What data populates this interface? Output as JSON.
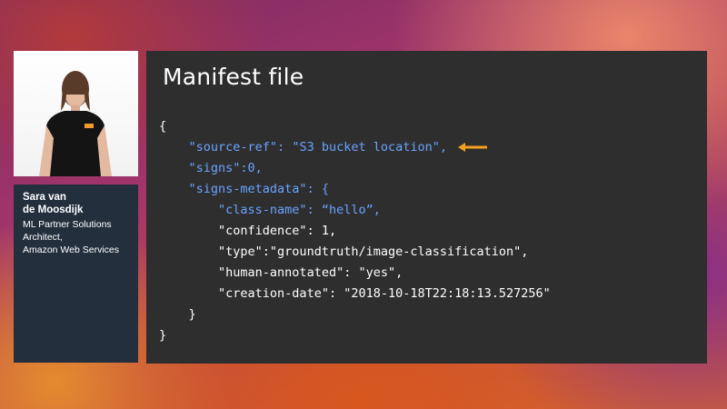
{
  "speaker": {
    "name_line1": "Sara van",
    "name_line2": "de Moosdijk",
    "title_line1": "ML Partner Solutions",
    "title_line2": "Architect,",
    "title_line3": "Amazon Web Services"
  },
  "slide": {
    "title": "Manifest file",
    "code_lines": [
      {
        "indent": "",
        "key": "",
        "rest": "{"
      },
      {
        "indent": "    ",
        "key": "\"source-ref\"",
        "rest": ": \"S3 bucket location\","
      },
      {
        "indent": "    ",
        "key": "\"signs\"",
        "rest": ":0,"
      },
      {
        "indent": "    ",
        "key": "\"signs-metadata\"",
        "rest": ": {"
      },
      {
        "indent": "        ",
        "key": "\"class-name\"",
        "rest": ": “hello”,"
      },
      {
        "indent": "        ",
        "key": "",
        "rest": "\"confidence\": 1,"
      },
      {
        "indent": "        ",
        "key": "",
        "rest": "\"type\":\"groundtruth/image-classification\","
      },
      {
        "indent": "        ",
        "key": "",
        "rest": "\"human-annotated\": \"yes\","
      },
      {
        "indent": "        ",
        "key": "",
        "rest": "\"creation-date\": \"2018-10-18T22:18:13.527256\""
      },
      {
        "indent": "    ",
        "key": "",
        "rest": "}"
      },
      {
        "indent": "",
        "key": "",
        "rest": "}"
      }
    ],
    "blue_rest_lines": [
      1,
      2,
      3,
      4
    ]
  },
  "colors": {
    "key_blue": "#6aa3ff",
    "arrow_orange": "#f5a020",
    "slide_bg": "#2e2e2e",
    "card_bg": "#242f3e"
  },
  "icons": {
    "arrow": "left-arrow-icon"
  }
}
